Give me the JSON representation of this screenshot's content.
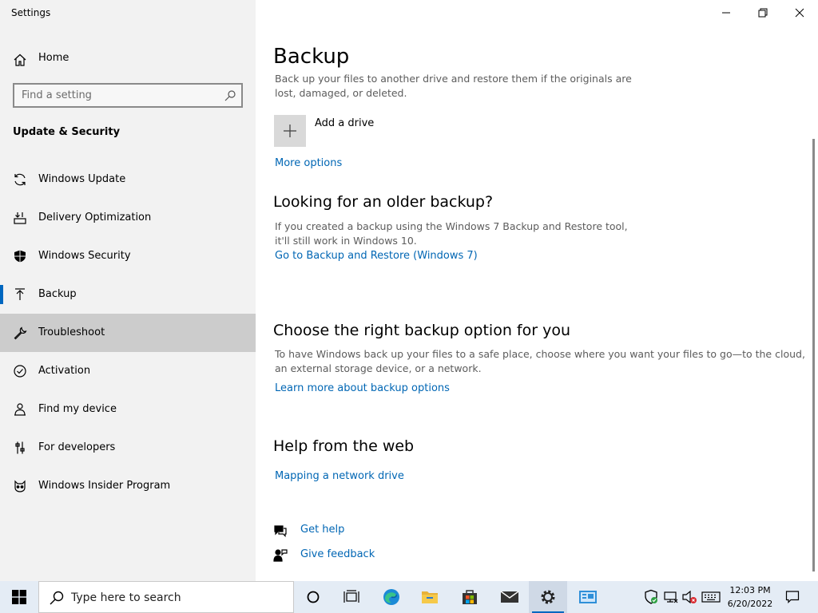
{
  "window": {
    "app_title": "Settings"
  },
  "sidebar": {
    "home_label": "Home",
    "search_placeholder": "Find a setting",
    "section_title": "Update & Security",
    "items": [
      {
        "label": "Windows Update",
        "icon": "sync-icon"
      },
      {
        "label": "Delivery Optimization",
        "icon": "delivery-optimization-icon"
      },
      {
        "label": "Windows Security",
        "icon": "shield-icon"
      },
      {
        "label": "Backup",
        "icon": "backup-arrow-icon",
        "selected": true
      },
      {
        "label": "Troubleshoot",
        "icon": "wrench-icon",
        "hovered": true
      },
      {
        "label": "Activation",
        "icon": "check-circle-icon"
      },
      {
        "label": "Find my device",
        "icon": "person-locate-icon"
      },
      {
        "label": "For developers",
        "icon": "developer-sliders-icon"
      },
      {
        "label": "Windows Insider Program",
        "icon": "insider-cat-icon"
      }
    ]
  },
  "main": {
    "title": "Backup",
    "intro": "Back up your files to another drive and restore them if the originals are lost, damaged, or deleted.",
    "add_drive_label": "Add a drive",
    "more_options_link": "More options",
    "older_backup": {
      "heading": "Looking for an older backup?",
      "description": "If you created a backup using the Windows 7 Backup and Restore tool, it'll still work in Windows 10.",
      "link": "Go to Backup and Restore (Windows 7)"
    },
    "right_option": {
      "heading": "Choose the right backup option for you",
      "description": "To have Windows back up your files to a safe place, choose where you want your files to go—to the cloud, an external storage device, or a network.",
      "link": "Learn more about backup options"
    },
    "help_web": {
      "heading": "Help from the web",
      "link": "Mapping a network drive"
    },
    "get_help_link": "Get help",
    "give_feedback_link": "Give feedback"
  },
  "taskbar": {
    "search_text": "Type here to search",
    "time": "12:03 PM",
    "date": "6/20/2022",
    "pinned": [
      "cortana-icon",
      "task-view-icon",
      "edge-icon",
      "file-explorer-icon",
      "store-icon",
      "mail-icon",
      "settings-icon",
      "control-panel-icon"
    ]
  },
  "colors": {
    "accent": "#0067c0",
    "link": "#0066b4",
    "sidebar_bg": "#f2f2f2",
    "taskbar_bg": "#e4ecf5"
  }
}
